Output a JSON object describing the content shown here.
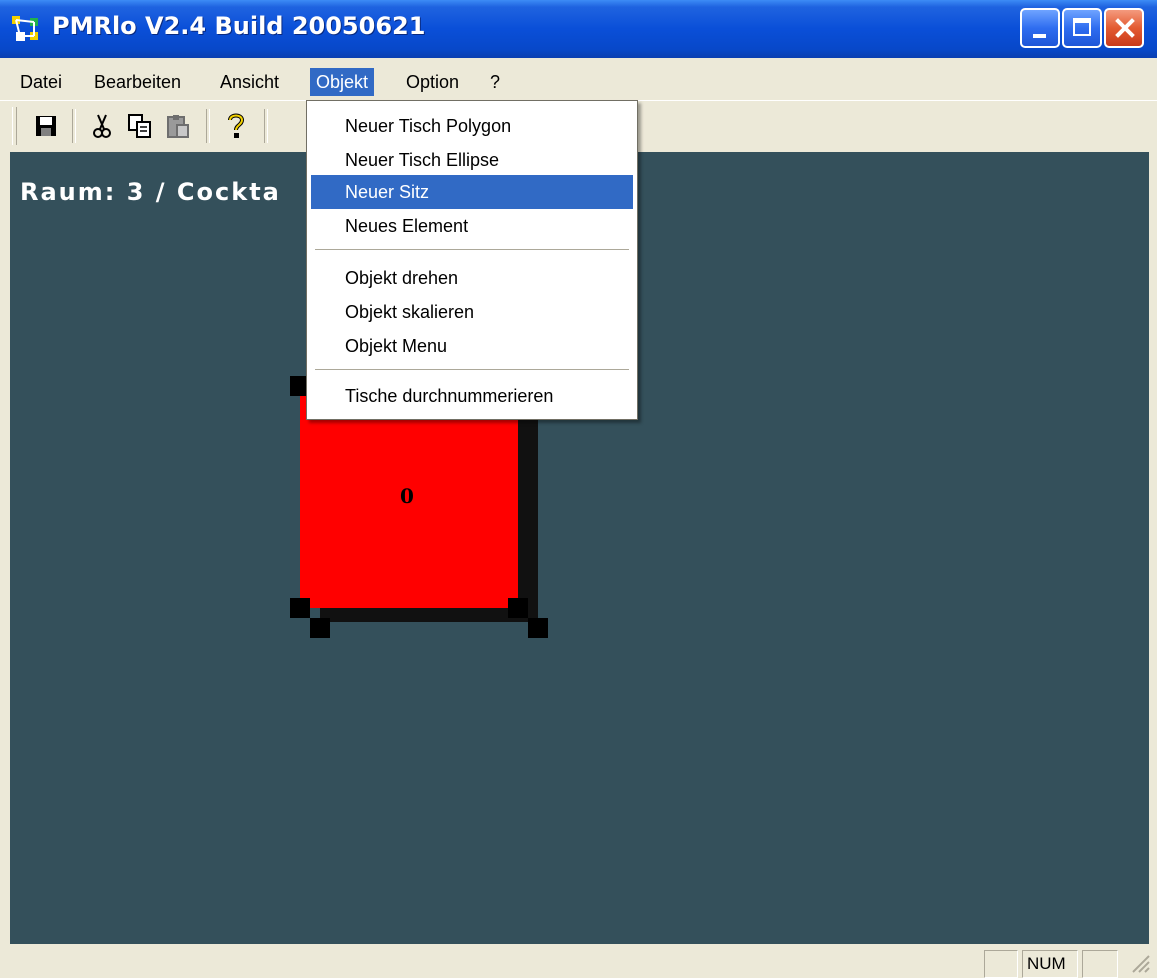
{
  "window": {
    "title": "PMRlo V2.4 Build 20050621"
  },
  "menubar": {
    "items": [
      {
        "label": "Datei"
      },
      {
        "label": "Bearbeiten"
      },
      {
        "label": "Ansicht"
      },
      {
        "label": "Objekt",
        "active": true
      },
      {
        "label": "Option"
      },
      {
        "label": "?"
      }
    ]
  },
  "toolbar": {
    "buttons": [
      "save-icon",
      "cut-icon",
      "copy-icon",
      "paste-icon",
      "help-icon"
    ]
  },
  "canvas": {
    "room_label": "Raum: 3 / Cockta",
    "table_number": "0",
    "background": "#34505B",
    "table_color": "#FF0000"
  },
  "objekt_menu": {
    "groups": [
      [
        "Neuer Tisch Polygon",
        "Neuer Tisch Ellipse",
        "Neuer Sitz",
        "Neues Element"
      ],
      [
        "Objekt drehen",
        "Objekt skalieren",
        "Objekt Menu"
      ],
      [
        "Tische durchnummerieren"
      ]
    ],
    "highlighted": "Neuer Sitz"
  },
  "statusbar": {
    "num": "NUM"
  },
  "colors": {
    "highlight": "#316AC5",
    "titlebar": "#0A4FD8",
    "chrome": "#ECE9D8"
  }
}
